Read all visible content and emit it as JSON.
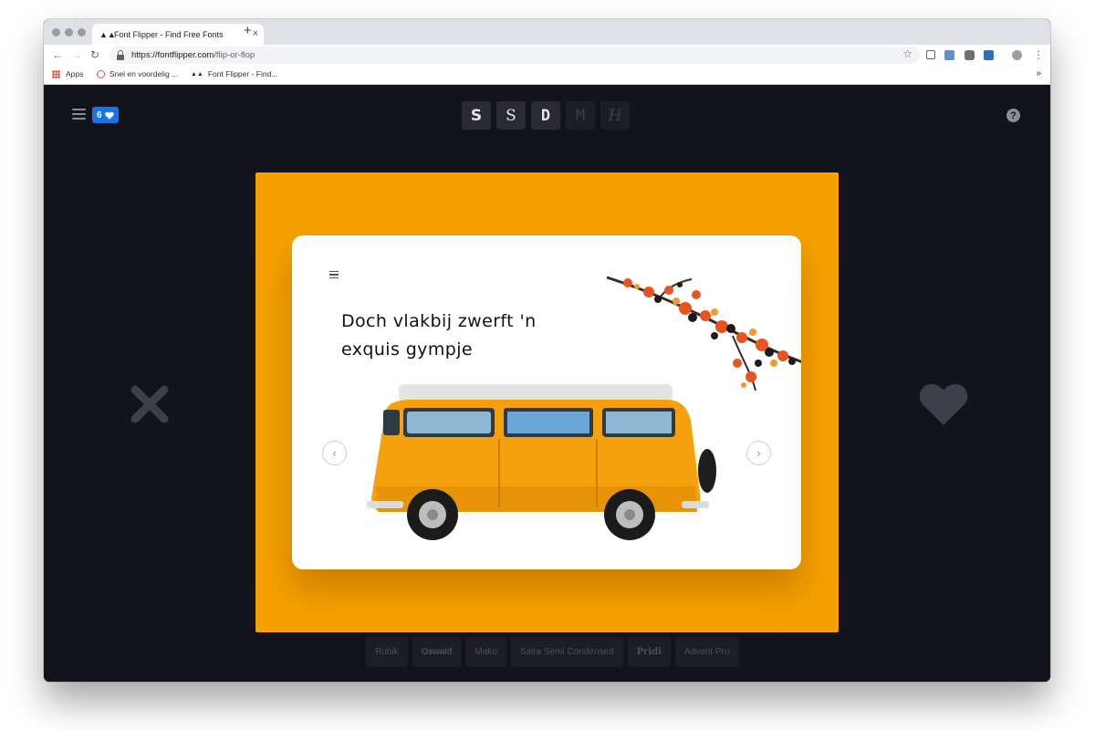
{
  "browser": {
    "tab_title": "Font Flipper - Find Free Fonts",
    "tab_close": "×",
    "new_tab": "+",
    "url_host": "https://fontflipper.com",
    "url_path": "/flip-or-flop",
    "bookmarks": [
      {
        "label": "Apps"
      },
      {
        "label": "Snel en voordelig ..."
      },
      {
        "label": "Font Flipper - Find..."
      }
    ],
    "bookmarks_more": "»"
  },
  "app": {
    "favorites_count": "6",
    "style_filters": [
      {
        "label": "S",
        "active": true
      },
      {
        "label": "S",
        "active": true
      },
      {
        "label": "D",
        "active": true
      },
      {
        "label": "M",
        "active": false
      },
      {
        "label": "H",
        "active": false
      }
    ],
    "help_icon": "?",
    "card": {
      "headline": "Doch vlakbij zwerft 'n exquis gympje"
    },
    "fonts": [
      "Rubik",
      "Oswald",
      "Mako",
      "Saira Semi Condensed",
      "Pridi",
      "Advent Pro"
    ],
    "colors": {
      "background": "#13131b",
      "stage": "#f6a100",
      "accent": "#1a74e8"
    }
  }
}
